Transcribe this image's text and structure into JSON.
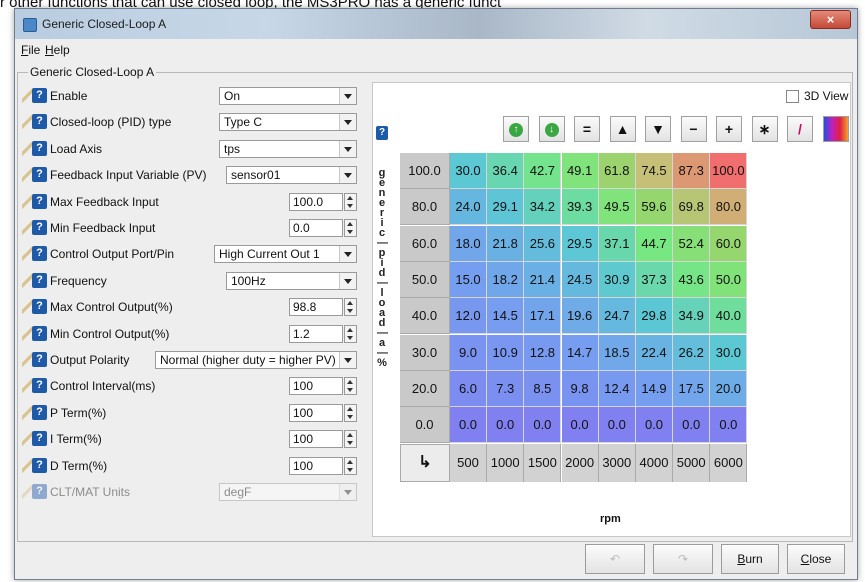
{
  "background_caption": "r other functions that can use closed loop, the MS3PRO has a generic funct",
  "window": {
    "title": "Generic Closed-Loop A",
    "close_symbol": "×"
  },
  "menu": {
    "file": "File",
    "help": "Help"
  },
  "frame_title": "Generic Closed-Loop A",
  "help_glyph": "?",
  "settings": [
    {
      "label": "Enable",
      "type": "combo",
      "value": "On"
    },
    {
      "label": "Closed-loop (PID) type",
      "type": "combo",
      "value": "Type C"
    },
    {
      "label": "Load Axis",
      "type": "combo",
      "value": "tps"
    },
    {
      "label": "Feedback Input Variable (PV)",
      "type": "combo",
      "value": "sensor01"
    },
    {
      "label": "Max Feedback Input",
      "type": "spin",
      "value": "100.0"
    },
    {
      "label": "Min Feedback Input",
      "type": "spin",
      "value": "0.0"
    },
    {
      "label": "Control Output Port/Pin",
      "type": "combo",
      "value": "High Current Out 1"
    },
    {
      "label": "Frequency",
      "type": "combo",
      "value": "100Hz"
    },
    {
      "label": "Max Control Output(%)",
      "type": "spin",
      "value": "98.8"
    },
    {
      "label": "Min Control Output(%)",
      "type": "spin",
      "value": "1.2"
    },
    {
      "label": "Output Polarity",
      "type": "combo",
      "value": "Normal (higher duty = higher PV)"
    },
    {
      "label": "Control Interval(ms)",
      "type": "spin",
      "value": "100"
    },
    {
      "label": "P Term(%)",
      "type": "spin",
      "value": "100"
    },
    {
      "label": "I Term(%)",
      "type": "spin",
      "value": "100"
    },
    {
      "label": "D Term(%)",
      "type": "spin",
      "value": "100"
    },
    {
      "label": "CLT/MAT Units",
      "type": "combo",
      "value": "degF",
      "disabled": true
    }
  ],
  "view3d_label": "3D View",
  "vertical_label": [
    "g",
    "e",
    "n",
    "e",
    "r",
    "i",
    "c",
    "",
    "p",
    "i",
    "d",
    "",
    "l",
    "o",
    "a",
    "d",
    "",
    "a",
    "",
    "%"
  ],
  "toolbar": [
    {
      "icon": "up-green-icon",
      "glyph": "↑"
    },
    {
      "icon": "down-green-icon",
      "glyph": "↓"
    },
    {
      "icon": "equals-icon",
      "glyph": "="
    },
    {
      "icon": "increase-icon",
      "glyph": "▲"
    },
    {
      "icon": "decrease-icon",
      "glyph": "▼"
    },
    {
      "icon": "minus-icon",
      "glyph": "−"
    },
    {
      "icon": "plus-icon",
      "glyph": "+"
    },
    {
      "icon": "multiply-icon",
      "glyph": "∗"
    },
    {
      "icon": "pen-icon",
      "glyph": "/"
    },
    {
      "icon": "color-palette-icon",
      "glyph": ""
    }
  ],
  "table": {
    "y_axis": [
      "100.0",
      "80.0",
      "60.0",
      "50.0",
      "40.0",
      "30.0",
      "20.0",
      "0.0"
    ],
    "x_axis": [
      "500",
      "1000",
      "1500",
      "2000",
      "3000",
      "4000",
      "5000",
      "6000"
    ],
    "x_label": "rpm",
    "corner_glyph": "↳",
    "rows": [
      [
        "30.0",
        "36.4",
        "42.7",
        "49.1",
        "61.8",
        "74.5",
        "87.3",
        "100.0"
      ],
      [
        "24.0",
        "29.1",
        "34.2",
        "39.3",
        "49.5",
        "59.6",
        "69.8",
        "80.0"
      ],
      [
        "18.0",
        "21.8",
        "25.6",
        "29.5",
        "37.1",
        "44.7",
        "52.4",
        "60.0"
      ],
      [
        "15.0",
        "18.2",
        "21.4",
        "24.5",
        "30.9",
        "37.3",
        "43.6",
        "50.0"
      ],
      [
        "12.0",
        "14.5",
        "17.1",
        "19.6",
        "24.7",
        "29.8",
        "34.9",
        "40.0"
      ],
      [
        "9.0",
        "10.9",
        "12.8",
        "14.7",
        "18.5",
        "22.4",
        "26.2",
        "30.0"
      ],
      [
        "6.0",
        "7.3",
        "8.5",
        "9.8",
        "12.4",
        "14.9",
        "17.5",
        "20.0"
      ],
      [
        "0.0",
        "0.0",
        "0.0",
        "0.0",
        "0.0",
        "0.0",
        "0.0",
        "0.0"
      ]
    ]
  },
  "buttons": {
    "undo": "↶",
    "redo": "↷",
    "burn": "Burn",
    "close": "Close"
  }
}
